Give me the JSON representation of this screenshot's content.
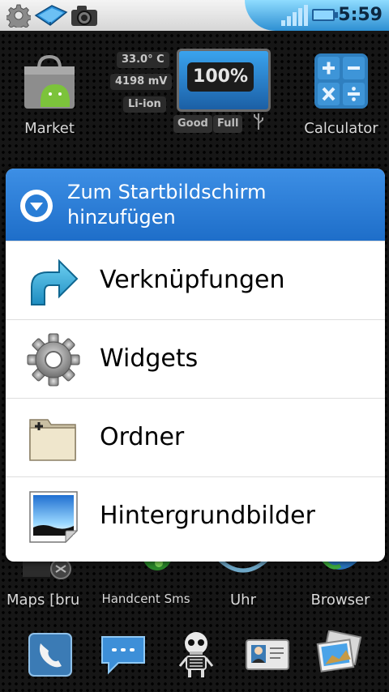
{
  "status_bar": {
    "time": "5:59",
    "icons": [
      "settings-gear-icon",
      "ebook-icon",
      "camera-icon",
      "signal-bars-icon",
      "battery-icon"
    ]
  },
  "home_screen": {
    "top_apps": [
      {
        "label": "Market",
        "icon": "market-bag-icon"
      },
      {
        "label": "Calculator",
        "icon": "calculator-icon"
      }
    ],
    "battery_widget": {
      "temperature": "33.0° C",
      "voltage": "4198 mV",
      "type": "Li-ion",
      "percent": "100%",
      "health": "Good",
      "status": "Full"
    },
    "bottom_apps": [
      {
        "label": "Maps [bru",
        "icon": "maps-icon"
      },
      {
        "label": "Handcent Sms",
        "icon": "handcent-sms-icon"
      },
      {
        "label": "Uhr",
        "icon": "clock-icon"
      },
      {
        "label": "Browser",
        "icon": "browser-globe-icon"
      }
    ],
    "dock": [
      "phone-icon",
      "messaging-icon",
      "skeleton-icon",
      "contacts-icon",
      "gallery-icon"
    ]
  },
  "dialog": {
    "title": "Zum Startbildschirm hinzufügen",
    "options": [
      {
        "label": "Verknüpfungen",
        "icon": "shortcut-arrow-icon"
      },
      {
        "label": "Widgets",
        "icon": "widget-gear-icon"
      },
      {
        "label": "Ordner",
        "icon": "folder-icon"
      },
      {
        "label": "Hintergrundbilder",
        "icon": "wallpaper-icon"
      }
    ]
  },
  "colors": {
    "dialog_header": "#2c7fd8",
    "status_bar_accent": "#4aa8e8",
    "time_text": "#0c2740"
  }
}
